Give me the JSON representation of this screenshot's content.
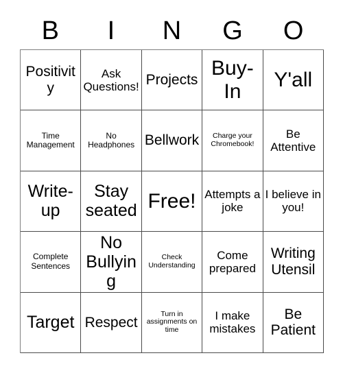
{
  "header": {
    "letters": [
      "B",
      "I",
      "N",
      "G",
      "O"
    ]
  },
  "grid": {
    "columns": 5,
    "rows": 5,
    "free_space_label": "Free!",
    "cells": [
      {
        "text": "Positivity",
        "size": "md"
      },
      {
        "text": "Ask Questions!",
        "size": "sm"
      },
      {
        "text": "Projects",
        "size": "md"
      },
      {
        "text": "Buy-In",
        "size": "xl"
      },
      {
        "text": "Y'all",
        "size": "xl"
      },
      {
        "text": "Time Management",
        "size": "xs"
      },
      {
        "text": "No Headphones",
        "size": "xs"
      },
      {
        "text": "Bellwork",
        "size": "md"
      },
      {
        "text": "Charge your Chromebook!",
        "size": "xxs"
      },
      {
        "text": "Be Attentive",
        "size": "sm"
      },
      {
        "text": "Write-up",
        "size": "lg"
      },
      {
        "text": "Stay seated",
        "size": "lg"
      },
      {
        "text": "Free!",
        "size": "xl"
      },
      {
        "text": "Attempts a joke",
        "size": "sm"
      },
      {
        "text": "I believe in you!",
        "size": "sm"
      },
      {
        "text": "Complete Sentences",
        "size": "xs"
      },
      {
        "text": "No Bullying",
        "size": "lg"
      },
      {
        "text": "Check Understanding",
        "size": "xxs"
      },
      {
        "text": "Come prepared",
        "size": "sm"
      },
      {
        "text": "Writing Utensil",
        "size": "md"
      },
      {
        "text": "Target",
        "size": "lg"
      },
      {
        "text": "Respect",
        "size": "md"
      },
      {
        "text": "Turn in assignments on time",
        "size": "xxs"
      },
      {
        "text": "I make mistakes",
        "size": "sm"
      },
      {
        "text": "Be Patient",
        "size": "md"
      }
    ]
  },
  "colors": {
    "background": "#ffffff",
    "text": "#000000",
    "border": "#4a4a4a"
  }
}
